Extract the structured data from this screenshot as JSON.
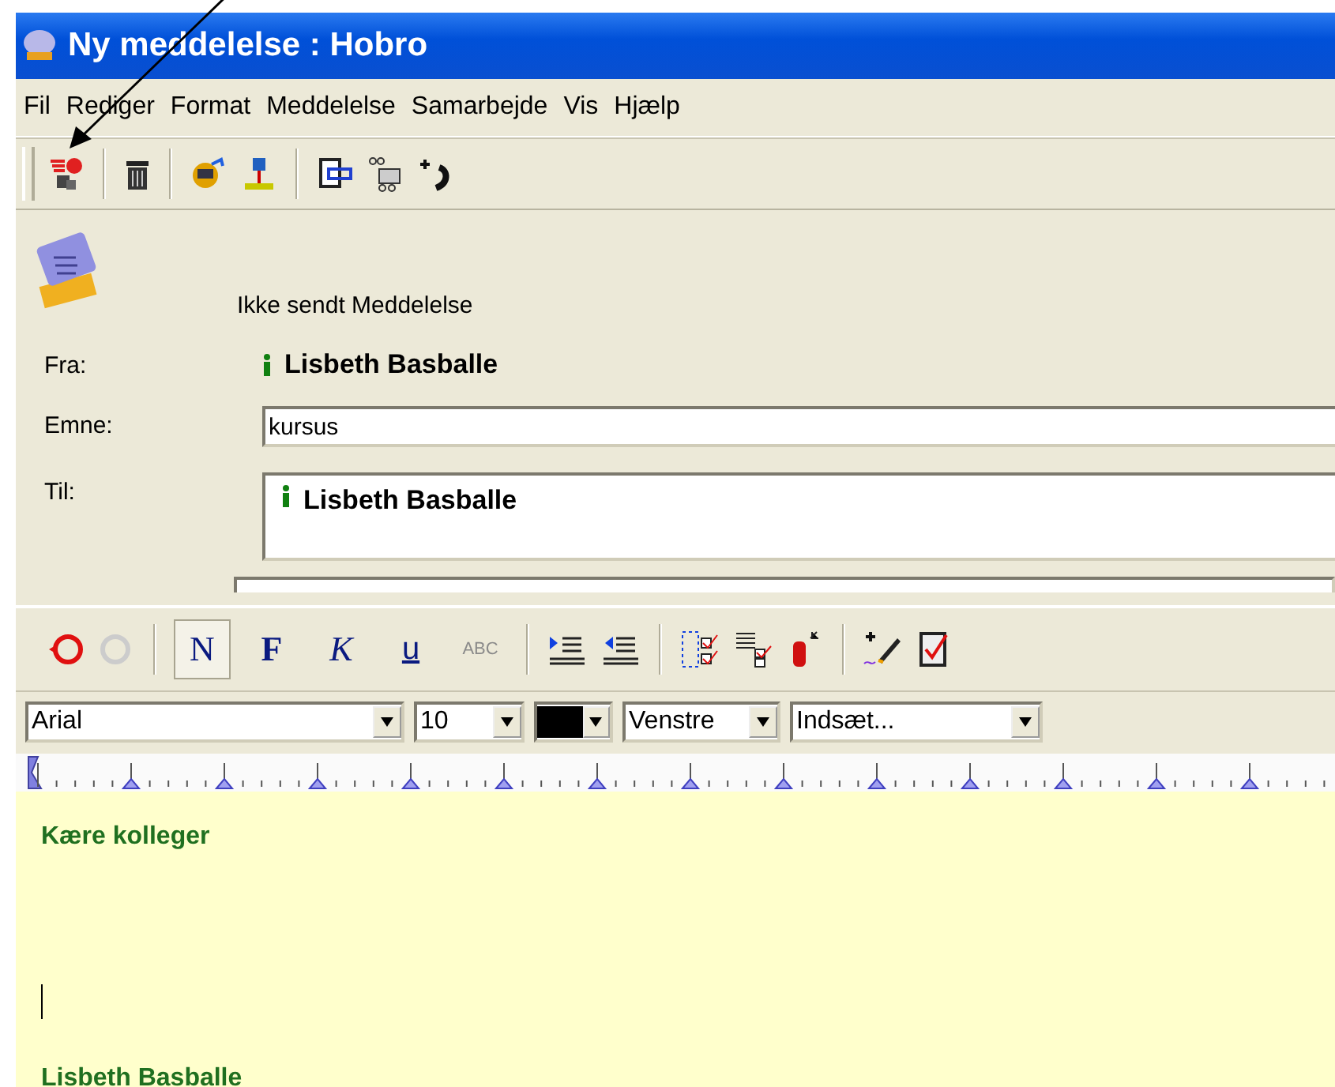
{
  "window": {
    "title": "Ny meddelelse : Hobro"
  },
  "menu": [
    "Fil",
    "Rediger",
    "Format",
    "Meddelelse",
    "Samarbejde",
    "Vis",
    "Hjælp"
  ],
  "header": {
    "status": "Ikke sendt Meddelelse",
    "fields": [
      {
        "kind": "name",
        "label": "Fra:",
        "value": "Lisbeth Basballe"
      },
      {
        "kind": "input",
        "label": "Emne:",
        "value": "kursus"
      },
      {
        "kind": "recipients",
        "label": "Til:",
        "value": "Lisbeth Basballe"
      }
    ]
  },
  "format_buttons": [
    {
      "label": "N",
      "selected": true,
      "disabled": false
    },
    {
      "label": "F",
      "selected": false,
      "disabled": false
    },
    {
      "label": "K",
      "selected": false,
      "disabled": false
    },
    {
      "label": "u",
      "selected": false,
      "disabled": false
    },
    {
      "label": "ABC",
      "selected": false,
      "disabled": true
    }
  ],
  "combos": [
    {
      "kind": "text",
      "value": "Arial"
    },
    {
      "kind": "text",
      "value": "10"
    },
    {
      "kind": "color",
      "color": "#000000"
    },
    {
      "kind": "text",
      "value": "Venstre"
    },
    {
      "kind": "text",
      "value": "Indsæt..."
    }
  ],
  "body": {
    "greeting": "Kære kolleger",
    "signature": "Lisbeth Basballe"
  }
}
